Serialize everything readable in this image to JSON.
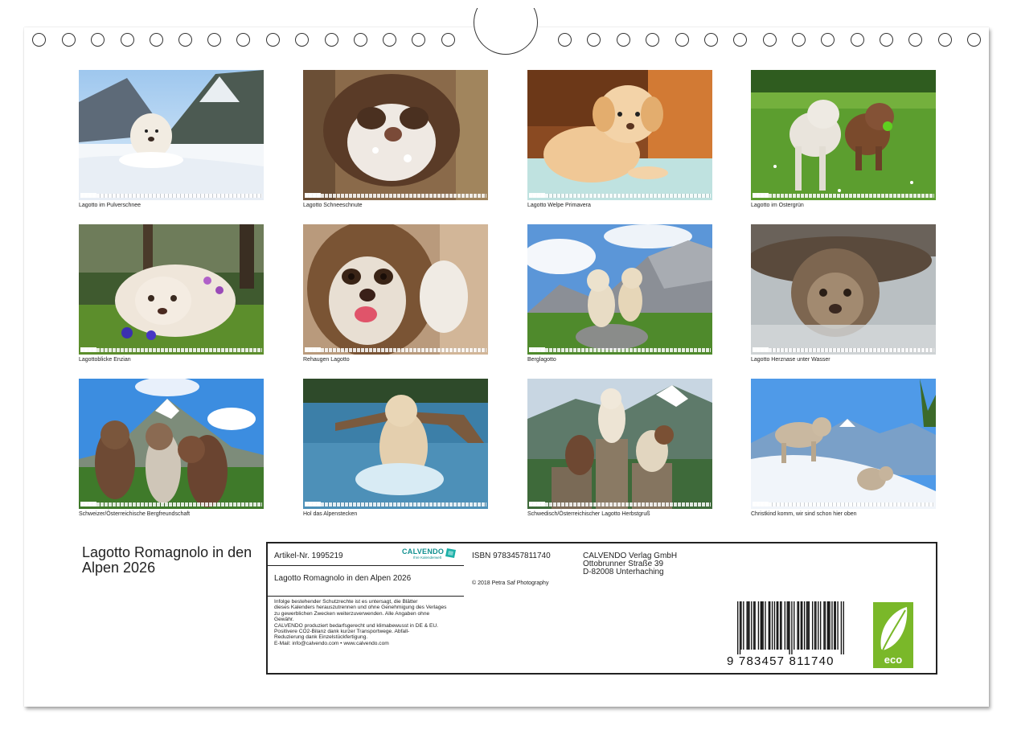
{
  "months": [
    {
      "caption": "Lagotto im Pulverschnee",
      "tab": "Januar"
    },
    {
      "caption": "Lagotto Schneeschnute",
      "tab": "Februar"
    },
    {
      "caption": "Lagotto Welpe Primavera",
      "tab": "März"
    },
    {
      "caption": "Lagotto im Ostergrün",
      "tab": "April"
    },
    {
      "caption": "Lagottoblicke Enzian",
      "tab": "Mai"
    },
    {
      "caption": "Rehaugen Lagotto",
      "tab": "Juni"
    },
    {
      "caption": "Berglagotto",
      "tab": "Juli"
    },
    {
      "caption": "Lagotto Herznase unter Wasser",
      "tab": "August"
    },
    {
      "caption": "Schweizer/Österreichische Bergfreundschaft",
      "tab": "September"
    },
    {
      "caption": "Hol das Alpenstecken",
      "tab": "Oktober"
    },
    {
      "caption": "Schwedisch/Österreichischer Lagotto Herbstgruß",
      "tab": "November"
    },
    {
      "caption": "Christkind komm, wir sind schon hier oben",
      "tab": "Dezember"
    }
  ],
  "title": "Lagotto Romagnolo in den Alpen 2026",
  "info": {
    "article": "Artikel-Nr. 1995219",
    "logo": "CALVENDO",
    "logo_sub": "Ihre Kalenderwelt",
    "box_title": "Lagotto Romagnolo in den Alpen 2026",
    "legal_lines": [
      "Infolge bestehender Schutzrechte ist es untersagt, die Blätter",
      "dieses Kalenders herauszutrennen und ohne Genehmigung des Verlages",
      "zu gewerblichen Zwecken weiterzuverwenden. Alle Angaben ohne",
      "Gewähr.",
      "CALVENDO produziert bedarfsgerecht und klimabewusst in DE & EU.",
      "Positivere CO2-Bilanz dank kurzer Transportwege. Abfall-",
      "Reduzierung dank Einzelstückfertigung.",
      "E-Mail: info@calvendo.com • www.calvendo.com"
    ],
    "isbn": "ISBN 9783457811740",
    "copyright": "© 2018 Petra Saf Photography",
    "publisher": [
      "CALVENDO Verlag GmbH",
      "Ottobrunner Straße 39",
      "D-82008 Unterhaching"
    ],
    "barcode_number": "9 783457 811740",
    "eco_label": "eco"
  },
  "colors": {
    "border": "#222222",
    "eco_green": "#7ab829",
    "logo_teal": "#0f8f8f"
  }
}
